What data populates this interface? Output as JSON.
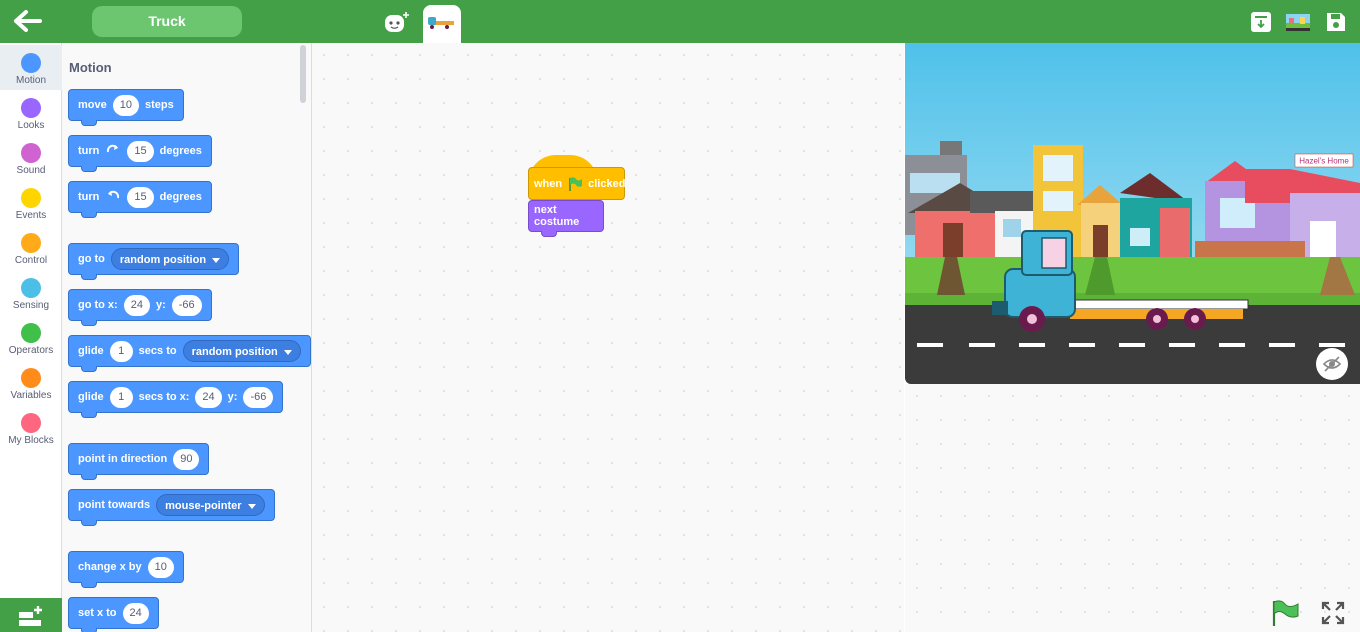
{
  "app": {
    "project_title": "Truck"
  },
  "toolbar": {
    "back_icon": "arrow-left-icon",
    "icons": [
      "download-icon",
      "stage-backdrop-icon",
      "save-icon"
    ]
  },
  "categories": [
    {
      "label": "Motion",
      "color": "#4c97ff"
    },
    {
      "label": "Looks",
      "color": "#9966ff"
    },
    {
      "label": "Sound",
      "color": "#cf63cf"
    },
    {
      "label": "Events",
      "color": "#ffd500"
    },
    {
      "label": "Control",
      "color": "#ffab19"
    },
    {
      "label": "Sensing",
      "color": "#4cbfe6"
    },
    {
      "label": "Operators",
      "color": "#40bf4a"
    },
    {
      "label": "Variables",
      "color": "#ff8c1a"
    },
    {
      "label": "My Blocks",
      "color": "#ff6680"
    }
  ],
  "palette": {
    "section_title": "Motion",
    "blocks": {
      "move": {
        "a": "move",
        "v": "10",
        "b": "steps"
      },
      "turn_right": {
        "a": "turn",
        "v": "15",
        "b": "degrees"
      },
      "turn_left": {
        "a": "turn",
        "v": "15",
        "b": "degrees"
      },
      "go_to": {
        "a": "go to",
        "d": "random position"
      },
      "go_to_xy": {
        "a": "go to x:",
        "x": "24",
        "b": "y:",
        "y": "-66"
      },
      "glide_to": {
        "a": "glide",
        "v": "1",
        "b": "secs to",
        "d": "random position"
      },
      "glide_xy": {
        "a": "glide",
        "v": "1",
        "b": "secs to x:",
        "x": "24",
        "c": "y:",
        "y": "-66"
      },
      "point_dir": {
        "a": "point in direction",
        "v": "90"
      },
      "point_towards": {
        "a": "point towards",
        "d": "mouse-pointer"
      },
      "change_x": {
        "a": "change x by",
        "v": "10"
      },
      "set_x": {
        "a": "set x to",
        "v": "24"
      }
    }
  },
  "script": {
    "hat": {
      "a": "when",
      "b": "clicked"
    },
    "costume": "next costume"
  },
  "stage": {
    "sign": "Hazel's Home"
  },
  "colors": {
    "topbar": "#43a047",
    "motion": "#4c97ff",
    "events": "#ffbf00",
    "looks": "#9966ff"
  }
}
